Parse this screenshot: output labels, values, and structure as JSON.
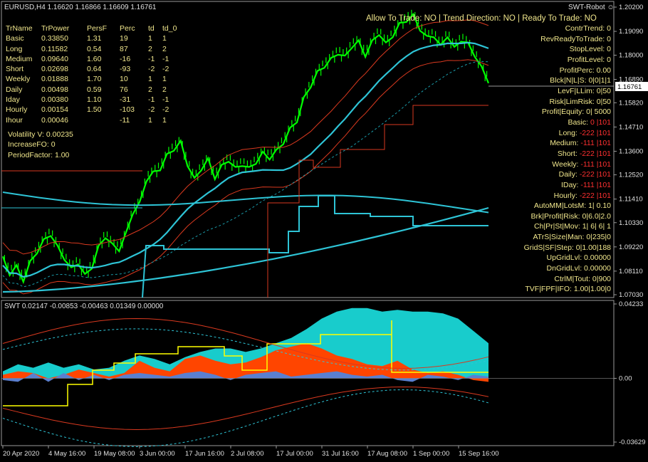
{
  "main_header": "EURUSD,H4  1.16620 1.16866 1.16609 1.16761",
  "robot_label": "SWT-Robot",
  "status_line": "Allow To Trade:   NO | Trend Direction: NO |  Ready To Trade: NO",
  "current_price": "1.16761",
  "sub_header": "SWT 0.02147 -0.00853 -0.00463 0.01349 0.00000",
  "colors": {
    "grid": "#222222",
    "border": "#9a9a9a",
    "price": "#00ff00",
    "cyan": "#2ec4d6",
    "red": "#d9391f",
    "fill_cyan": "#18cccc",
    "fill_orange": "#ff4500",
    "fill_blue": "#5a7fd0",
    "yellow": "#ffff00",
    "text": "#f0e68c"
  },
  "table": {
    "headers": [
      "TrName",
      "TrPower",
      "PersF",
      "Perc",
      "td",
      "td_0"
    ],
    "rows": [
      [
        "Basic",
        "0.33850",
        "1.31",
        "19",
        "1",
        "1"
      ],
      [
        "Long",
        "0.11582",
        "0.54",
        "87",
        "2",
        "2"
      ],
      [
        "Medium",
        "0.09640",
        "1.60",
        "-16",
        "-1",
        "-1"
      ],
      [
        "Short",
        "0.02698",
        "0.64",
        "-93",
        "-2",
        "-2"
      ],
      [
        "Weekly",
        "0.01888",
        "1.70",
        "10",
        "1",
        "1"
      ],
      [
        "Daily",
        "0.00498",
        "0.59",
        "76",
        "2",
        "2"
      ],
      [
        "Iday",
        "0.00380",
        "1.10",
        "-31",
        "-1",
        "-1"
      ],
      [
        "Hourly",
        "0.00154",
        "1.50",
        "-103",
        "-2",
        "-2"
      ],
      [
        "Ihour",
        "0.00046",
        "",
        "-11",
        "1",
        "1"
      ]
    ],
    "extra": [
      "Volatility V:  0.00235",
      "IncreaseFO:  0",
      "PeriodFactor:  1.00"
    ]
  },
  "right_panel": [
    {
      "label": "ContrTrend:",
      "value": "0",
      "neg": false
    },
    {
      "label": "RevReadyToTrade:",
      "value": "0",
      "neg": false
    },
    {
      "label": "StopLevel:",
      "value": "0",
      "neg": false
    },
    {
      "label": "ProfitLevel:",
      "value": "0",
      "neg": false
    },
    {
      "label": "ProfitPerc:",
      "value": "0.00",
      "neg": false
    },
    {
      "label": "Blck|N|L|S:",
      "value": "0|0|1|1",
      "neg": false
    },
    {
      "label": "LevF|LLim:",
      "value": "0|50",
      "neg": false
    },
    {
      "label": "Risk|LimRisk:",
      "value": "0|50",
      "neg": false
    },
    {
      "label": "Profit|Equity:",
      "value": "0|  5000",
      "neg": false
    },
    {
      "label": "Basic:",
      "value": "0 |101",
      "neg": true
    },
    {
      "label": "Long:",
      "value": "-222 |101",
      "neg": true
    },
    {
      "label": "Medium:",
      "value": "-111 |101",
      "neg": true
    },
    {
      "label": "Short:",
      "value": "-222 |101",
      "neg": true
    },
    {
      "label": "Weekly:",
      "value": "-111 |101",
      "neg": true
    },
    {
      "label": "Daily:",
      "value": "-222 |101",
      "neg": true
    },
    {
      "label": "IDay:",
      "value": "-111 |101",
      "neg": true
    },
    {
      "label": "Hourly:",
      "value": "-222 |101",
      "neg": true
    },
    {
      "label": "AutoMM|LotsM:",
      "value": "1| 0.10",
      "neg": false
    },
    {
      "label": "Brk|Profit|Risk:",
      "value": "0|6.0|2.0",
      "neg": false
    },
    {
      "label": "Ch|Pr|St|Mov:",
      "value": "1|  6|  6|  1",
      "neg": false
    },
    {
      "label": "ATrS|Size|Man:",
      "value": "0|235|0",
      "neg": false
    },
    {
      "label": "GridS|SF|Step:",
      "value": "0|1.00|188",
      "neg": false
    },
    {
      "label": "UpGridLvl:",
      "value": "0.00000",
      "neg": false
    },
    {
      "label": "DnGridLvl:",
      "value": "0.00000",
      "neg": false
    },
    {
      "label": "CtrlM|Tout:",
      "value": "0|900",
      "neg": false
    },
    {
      "label": "TVF|FPF|IFO:",
      "value": "1.00|1.00|0",
      "neg": false
    }
  ],
  "chart_data": [
    {
      "type": "line",
      "name": "EURUSD,H4",
      "y_ticks": [
        "1.20200",
        "1.19090",
        "1.18000",
        "1.16890",
        "1.15820",
        "1.14710",
        "1.13600",
        "1.12520",
        "1.11410",
        "1.10330",
        "1.09220",
        "1.08110",
        "1.07030"
      ],
      "ylim": [
        1.0703,
        1.202
      ],
      "x_ticks": [
        "20 Apr 2020",
        "4 May 16:00",
        "19 May 08:00",
        "3 Jun 00:00",
        "17 Jun 16:00",
        "2 Jul 08:00",
        "17 Jul 00:00",
        "31 Jul 16:00",
        "17 Aug 08:00",
        "1 Sep 00:00",
        "15 Sep 16:00"
      ],
      "price": [
        1.087,
        1.08,
        1.083,
        1.077,
        1.085,
        1.09,
        1.095,
        1.098,
        1.092,
        1.087,
        1.082,
        1.085,
        1.079,
        1.083,
        1.092,
        1.097,
        1.093,
        1.091,
        1.098,
        1.108,
        1.112,
        1.123,
        1.126,
        1.128,
        1.134,
        1.137,
        1.14,
        1.13,
        1.123,
        1.128,
        1.132,
        1.124,
        1.129,
        1.132,
        1.128,
        1.13,
        1.128,
        1.131,
        1.135,
        1.133,
        1.136,
        1.14,
        1.146,
        1.15,
        1.16,
        1.166,
        1.172,
        1.175,
        1.178,
        1.181,
        1.179,
        1.184,
        1.186,
        1.18,
        1.186,
        1.19,
        1.185,
        1.189,
        1.194,
        1.196,
        1.198,
        1.192,
        1.188,
        1.189,
        1.184,
        1.189,
        1.183,
        1.187,
        1.185,
        1.18,
        1.174,
        1.168
      ]
    },
    {
      "type": "area",
      "name": "SWT",
      "y_ticks": [
        "0.04233",
        "0.00",
        "-0.03629"
      ],
      "ylim": [
        -0.03629,
        0.04233
      ],
      "cyan_envelope": [
        0.004,
        0.008,
        0.006,
        0.009,
        0.006,
        0.008,
        0.005,
        0.006,
        0.01,
        0.013,
        0.011,
        0.008,
        0.012,
        0.015,
        0.017,
        0.017,
        0.015,
        0.017,
        0.02,
        0.023,
        0.028,
        0.034,
        0.038,
        0.04,
        0.04,
        0.038,
        0.039,
        0.038,
        0.038,
        0.037,
        0.034,
        0.027,
        0.02
      ],
      "orange": [
        0.002,
        0.004,
        0.003,
        0.0,
        0.002,
        0.005,
        0.003,
        0.001,
        0.003,
        0.01,
        0.006,
        0.004,
        0.011,
        0.013,
        0.01,
        0.008,
        0.009,
        0.012,
        0.016,
        0.018,
        0.02,
        0.017,
        0.013,
        0.011,
        0.008,
        0.007,
        0.01,
        0.005,
        0.003,
        0.004,
        0.002,
        -0.001,
        -0.002
      ],
      "blue": [
        -0.001,
        -0.002,
        0.003,
        -0.002,
        0.003,
        -0.001,
        0.002,
        -0.001,
        0.002,
        0.003,
        0.002,
        0.001,
        0.003,
        0.004,
        0.002,
        -0.001,
        0.002,
        0.003,
        0.004,
        0.001,
        0.002,
        0.003,
        0.004,
        0.002,
        0.001,
        0.002,
        -0.001,
        -0.002,
        0.002,
        0.001,
        -0.001,
        0.002,
        0.001
      ]
    }
  ]
}
